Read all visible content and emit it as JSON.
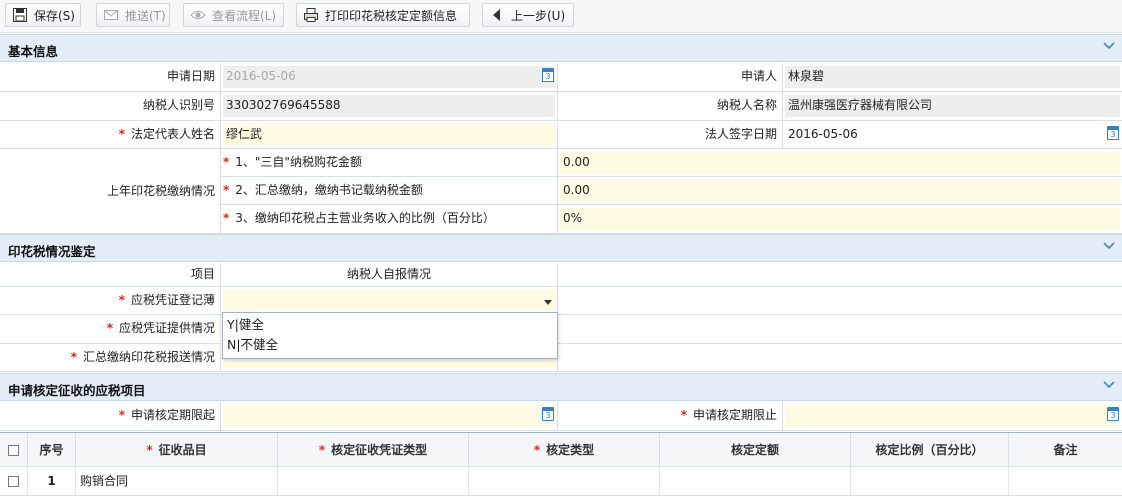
{
  "toolbar": {
    "save": "保存(S)",
    "push": "推送(T)",
    "view_flow": "查看流程(L)",
    "print": "打印印花税核定定额信息",
    "back": "上一步(U)"
  },
  "basic": {
    "title": "基本信息",
    "apply_date_label": "申请日期",
    "apply_date": "2016-05-06",
    "applicant_label": "申请人",
    "applicant": "林泉碧",
    "taxpayer_id_label": "纳税人识别号",
    "taxpayer_id": "330302769645588",
    "taxpayer_name_label": "纳税人名称",
    "taxpayer_name": "温州康强医疗器械有限公司",
    "legal_rep_label": "法定代表人姓名",
    "legal_rep": "缪仁武",
    "legal_sign_date_label": "法人签字日期",
    "legal_sign_date": "2016-05-06",
    "last_year_label": "上年印花税缴纳情况",
    "last_year_items": [
      {
        "label": "1、\"三自\"纳税购花金额",
        "value": "0.00"
      },
      {
        "label": "2、汇总缴纳，缴纳书记载纳税金额",
        "value": "0.00"
      },
      {
        "label": "3、缴纳印花税占主营业务收入的比例（百分比）",
        "value": "0%"
      }
    ]
  },
  "stamp": {
    "title": "印花税情况鉴定",
    "col_item": "项目",
    "col_self": "纳税人自报情况",
    "rows": [
      {
        "label": "应税凭证登记薄"
      },
      {
        "label": "应税凭证提供情况"
      },
      {
        "label": "汇总缴纳印花税报送情况"
      }
    ],
    "options": [
      "Y|健全",
      "N|不健全"
    ]
  },
  "apply": {
    "title": "申请核定征收的应税项目",
    "start_label": "申请核定期限起",
    "end_label": "申请核定期限止",
    "cal_digit": "3"
  },
  "grid": {
    "columns": [
      "序号",
      "征收品目",
      "核定征收凭证类型",
      "核定类型",
      "核定定额",
      "核定比例（百分比）",
      "备注"
    ],
    "rows": [
      {
        "no": "1",
        "item": "购销合同"
      }
    ]
  },
  "colors": {
    "section_bg": "#e2edf8",
    "required": "#e02020",
    "input_yellow": "#fffbe3",
    "readonly_gray": "#eeeeee"
  }
}
